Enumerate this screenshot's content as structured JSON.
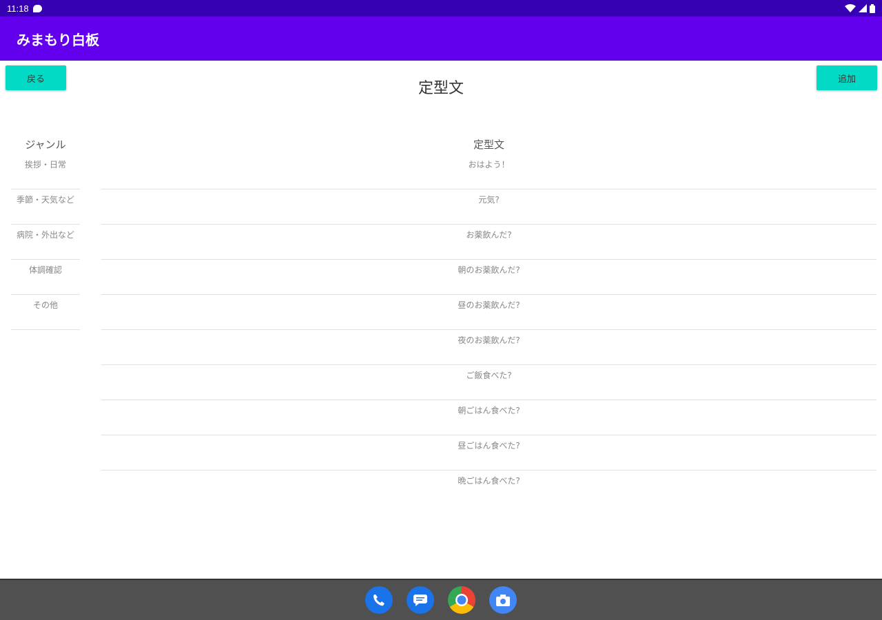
{
  "status": {
    "time": "11:18"
  },
  "app_bar": {
    "title": "みまもり白板"
  },
  "toolbar": {
    "back_label": "戻る",
    "add_label": "追加"
  },
  "page": {
    "title": "定型文"
  },
  "genre_list": {
    "header": "ジャンル",
    "items": [
      "挨拶・日常",
      "季節・天気など",
      "病院・外出など",
      "体調確認",
      "その他"
    ]
  },
  "phrase_list": {
    "header": "定型文",
    "items": [
      "おはよう！",
      "元気?",
      "お薬飲んだ?",
      "朝のお薬飲んだ?",
      "昼のお薬飲んだ?",
      "夜のお薬飲んだ?",
      "ご飯食べた?",
      "朝ごはん食べた?",
      "昼ごはん食べた?",
      "晩ごはん食べた?"
    ]
  },
  "dock": {
    "icons": [
      "phone-icon",
      "messages-icon",
      "chrome-icon",
      "camera-icon"
    ]
  }
}
